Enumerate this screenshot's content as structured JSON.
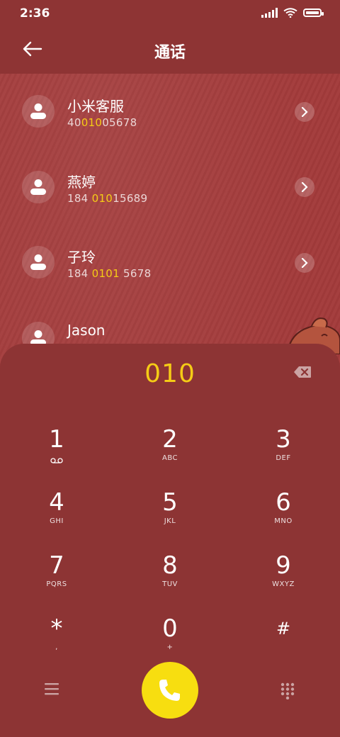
{
  "status_bar": {
    "time": "2:36"
  },
  "header": {
    "title": "通话"
  },
  "contacts": [
    {
      "name": "小米客服",
      "number_parts": [
        "40",
        "010",
        "05678"
      ]
    },
    {
      "name": "燕婷",
      "number_parts": [
        "184 ",
        "010",
        "15689"
      ]
    },
    {
      "name": "子玲",
      "number_parts": [
        "184 ",
        "0101",
        " 5678"
      ]
    },
    {
      "name": "Jason",
      "number_parts": [
        "",
        "",
        ""
      ]
    }
  ],
  "dialpad": {
    "entered": "010",
    "keys": [
      {
        "num": "1",
        "sub": "voicemail-icon"
      },
      {
        "num": "2",
        "sub": "ABC"
      },
      {
        "num": "3",
        "sub": "DEF"
      },
      {
        "num": "4",
        "sub": "GHI"
      },
      {
        "num": "5",
        "sub": "JKL"
      },
      {
        "num": "6",
        "sub": "MNO"
      },
      {
        "num": "7",
        "sub": "PQRS"
      },
      {
        "num": "8",
        "sub": "TUV"
      },
      {
        "num": "9",
        "sub": "WXYZ"
      },
      {
        "num": "*",
        "sub": ","
      },
      {
        "num": "0",
        "sub": "+"
      },
      {
        "num": "#",
        "sub": ""
      }
    ]
  },
  "colors": {
    "accent": "#f5cc16",
    "call": "#f7de10",
    "panel": "#8d3434",
    "background": "#a33b3b"
  }
}
